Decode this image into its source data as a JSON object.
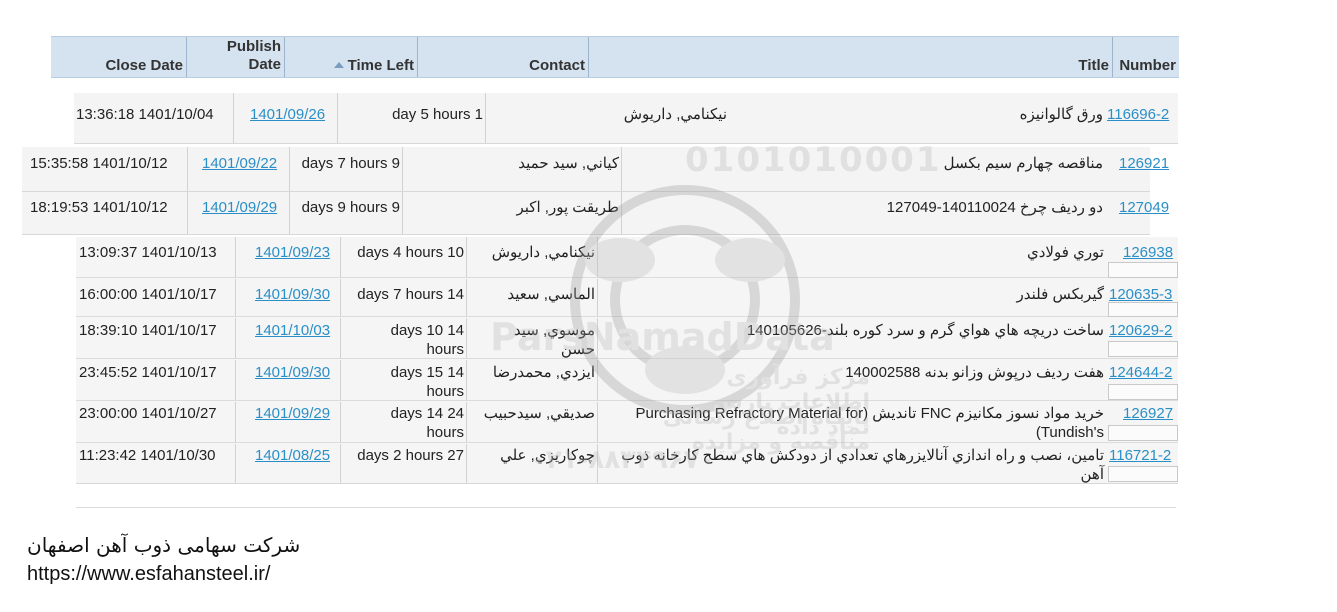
{
  "columns": {
    "close_date": "Close Date",
    "publish_date_line1": "Publish",
    "publish_date_line2": "Date",
    "time_left": "Time Left",
    "contact": "Contact",
    "title": "Title",
    "number": "Number"
  },
  "rows": [
    {
      "number": "116696-2",
      "title": "ورق گالوانيزه",
      "contact": "نيكنامي, داريوش",
      "time_left": "day 5 hours 1",
      "publish": "1401/09/26",
      "close": "13:36:18 1401/10/04"
    },
    {
      "number": "126921",
      "title": "مناقصه چهارم سيم بكسل",
      "contact": "كياني, سيد حميد",
      "time_left": "days 7 hours 9",
      "publish": "1401/09/22",
      "close": "15:35:58 1401/10/12"
    },
    {
      "number": "127049",
      "title": "دو رديف چرخ 140110024-127049",
      "contact": "طريقت پور, اكبر",
      "time_left": "days 9 hours 9",
      "publish": "1401/09/29",
      "close": "18:19:53 1401/10/12"
    },
    {
      "number": "126938",
      "title": "توري فولادي",
      "contact": "نيكنامي, داريوش",
      "time_left": "days 4 hours 10",
      "publish": "1401/09/23",
      "close": "13:09:37 1401/10/13"
    },
    {
      "number": "120635-3",
      "title": "گيربكس فلندر",
      "contact": "الماسي, سعيد",
      "time_left": "days 7 hours 14",
      "publish": "1401/09/30",
      "close": "16:00:00 1401/10/17"
    },
    {
      "number": "120629-2",
      "title": "ساخت دريچه هاي هواي گرم و سرد كوره بلند-140105626",
      "contact": "موسوي, سيد حسن",
      "time_left": "days 10 14 hours",
      "publish": "1401/10/03",
      "close": "18:39:10 1401/10/17"
    },
    {
      "number": "124644-2",
      "title": "هفت رديف درپوش وزانو بدنه 140002588",
      "contact": "ايزدي, محمدرضا",
      "time_left": "days 15 14 hours",
      "publish": "1401/09/30",
      "close": "23:45:52 1401/10/17"
    },
    {
      "number": "126927",
      "title": "خريد مواد نسوز مكانيزم FNC تانديش (Purchasing Refractory Material for Tundish's)",
      "contact": "صديقي, سيدحبيب",
      "time_left": "days 14 24 hours",
      "publish": "1401/09/29",
      "close": "23:00:00 1401/10/27"
    },
    {
      "number": "116721-2",
      "title": "تامين، نصب و راه اندازي آنالايزرهاي تعدادي از دودكش هاي سطح كارخانه ذوب آهن",
      "contact": "چوكاريزي, علي",
      "time_left": "days 2 hours 27",
      "publish": "1401/08/25",
      "close": "11:23:42 1401/10/30"
    }
  ],
  "watermark": {
    "brand": "ParsNamadData",
    "binary": "0101010001",
    "tagline": "مرکز فرآوری اطلاعات پارس نماد داده",
    "site": "پایگاه اطلاع رسانی مناقصه و مزایده",
    "phone": "۰۲۱-۸۸۳۴۹۶۷۰"
  },
  "footer": {
    "company": "شرکت سهامی ذوب آهن اصفهان",
    "url": "https://www.esfahansteel.ir/"
  }
}
